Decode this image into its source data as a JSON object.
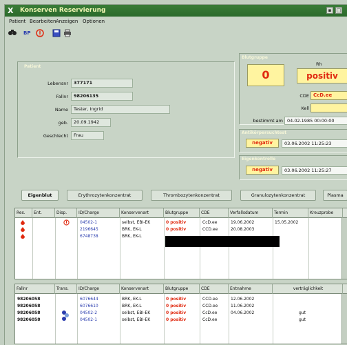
{
  "app": {
    "title": "Konserven Reservierung",
    "logo": "X",
    "win_btn_1": "▪",
    "win_btn_2": "□"
  },
  "menu": [
    "Patient",
    "Bearbeiten",
    "Anzeigen",
    "Optionen"
  ],
  "toolbar": [
    "binoculars-icon",
    "blood-icon",
    "alert-icon",
    "save-icon",
    "print-icon"
  ],
  "patient": {
    "title": "Patient",
    "fields": [
      {
        "label": "Lebensnr",
        "value": "377171"
      },
      {
        "label": "Fallnr",
        "value": "98206135"
      },
      {
        "label": "Name",
        "value": "Tester, Ingrid"
      },
      {
        "label": "geb.",
        "value": "20.09.1942"
      },
      {
        "label": "Geschlecht",
        "value": "Frau"
      }
    ]
  },
  "blood": {
    "title": "Blutgruppe",
    "group": "0",
    "rh_label": "Rh",
    "rh_value": "positiv",
    "cde_label": "CDE",
    "cde_value": "CcD.ee",
    "kell_label": "Kell",
    "kell_value": "",
    "confirmed_label": "bestimmt am",
    "confirmed_value": "04.02.1985 00:00:00",
    "antibody_title": "Antikörpersuchtest",
    "antibody_value": "negativ",
    "antibody_date": "03.06.2002 11:25:23",
    "selfcheck_title": "Eigenkontrolle",
    "selfcheck_value": "negativ",
    "selfcheck_date": "03.06.2002 11:25:27"
  },
  "tabs": [
    "Eigenblut",
    "Erythrozytenkonzentrat",
    "Thrombozytenkonzentrat",
    "Granulozytenkonzentrat",
    "Plasma"
  ],
  "table1": {
    "headers": [
      "Res.",
      "Ent.",
      "Disp.",
      "ID/Charge",
      "Konservenart",
      "Blutgruppe",
      "CDE",
      "Verfallsdatum",
      "Termin",
      "Kreuzprobe"
    ],
    "rows": [
      {
        "charge": "04502-1",
        "art": "selbst, EBI-EK",
        "bg": "0 positiv",
        "cde": "CcD.ee",
        "verfall": "19.06.2002",
        "termin": "15.05.2002"
      },
      {
        "charge": "2196645",
        "art": "BRK, EK-L",
        "bg": "0 positiv",
        "cde": "CCD.ee",
        "verfall": "20.08.2003",
        "termin": ""
      },
      {
        "charge": "6748738",
        "art": "BRK, EK-L",
        "bg": "",
        "cde": "",
        "verfall": "",
        "termin": ""
      }
    ]
  },
  "table2": {
    "headers": [
      "Fallnr",
      "Trans.",
      "ID/Charge",
      "Konservenart",
      "Blutgruppe",
      "CDE",
      "Entnahme",
      "verträglichkeit"
    ],
    "rows": [
      {
        "fall": "98206058",
        "charge": "6076644",
        "art": "BRK, EK-L",
        "bg": "0 positiv",
        "cde": "CCD.ee",
        "entnahme": "12.06.2002",
        "vt": ""
      },
      {
        "fall": "98206058",
        "charge": "6076610",
        "art": "BRK, EK-L",
        "bg": "0 positiv",
        "cde": "CCD.ee",
        "entnahme": "11.06.2002",
        "vt": ""
      },
      {
        "fall": "98206058",
        "charge": "04502-2",
        "art": "selbst, EBI-EK",
        "bg": "0 positiv",
        "cde": "CcD.ee",
        "entnahme": "04.06.2002",
        "vt": "gut"
      },
      {
        "fall": "98206058",
        "charge": "04502-1",
        "art": "selbst, EBI-EK",
        "bg": "0 positiv",
        "cde": "CcD.ee",
        "entnahme": "",
        "vt": "gut"
      }
    ]
  },
  "colors": {
    "title_bar": "#2f6f2f",
    "accent_red": "#e02a10",
    "yellow": "#fff4a0",
    "background": "#c8d4c6"
  }
}
